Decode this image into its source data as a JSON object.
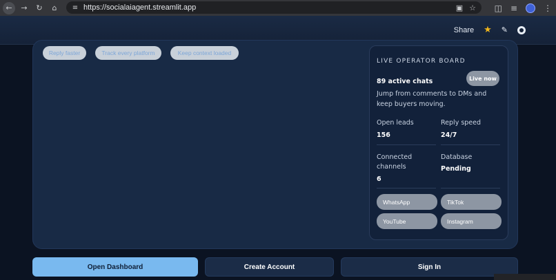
{
  "browser": {
    "url": "https://socialaiagent.streamlit.app"
  },
  "header": {
    "share_label": "Share"
  },
  "chips": [
    "Reply faster",
    "Track every platform",
    "Keep context loaded"
  ],
  "board": {
    "title": "LIVE OPERATOR BOARD",
    "live_label": "Live now",
    "active_chats": "89 active chats",
    "description": "Jump from comments to DMs and keep buyers moving.",
    "stats": [
      {
        "label": "Open leads",
        "value": "156"
      },
      {
        "label": "Reply speed",
        "value": "24/7"
      },
      {
        "label": "Connected channels",
        "value": "6"
      },
      {
        "label": "Database",
        "value": "Pending"
      }
    ],
    "channels": [
      "WhatsApp",
      "TikTok",
      "YouTube",
      "Instagram"
    ]
  },
  "actions": {
    "open_dashboard": "Open Dashboard",
    "create_account": "Create Account",
    "sign_in": "Sign In"
  },
  "colors": {
    "accent": "#79b9ef",
    "star": "#f2b71b",
    "pill": "#8d96a3"
  }
}
